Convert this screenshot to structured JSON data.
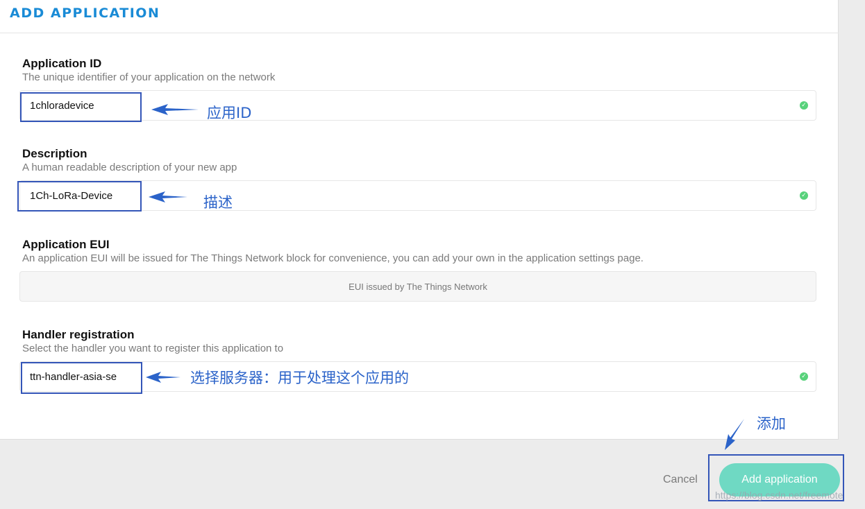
{
  "header": {
    "title": "ADD APPLICATION"
  },
  "fields": {
    "app_id": {
      "label": "Application ID",
      "help": "The unique identifier of your application on the network",
      "value": "1chloradevice",
      "annotation": "应用ID"
    },
    "description": {
      "label": "Description",
      "help": "A human readable description of your new app",
      "value": "1Ch-LoRa-Device",
      "annotation": "描述"
    },
    "eui": {
      "label": "Application EUI",
      "help": "An application EUI will be issued for The Things Network block for convenience, you can add your own in the application settings page.",
      "placeholder": "EUI issued by The Things Network"
    },
    "handler": {
      "label": "Handler registration",
      "help": "Select the handler you want to register this application to",
      "value": "ttn-handler-asia-se",
      "annotation": "选择服务器：用于处理这个应用的"
    }
  },
  "footer": {
    "cancel_label": "Cancel",
    "add_label": "Add application",
    "add_annotation": "添加"
  },
  "watermark": "https://blog.csdn.net/freemote",
  "colors": {
    "title": "#1a8bd6",
    "annotation": "#2b63c9",
    "valid": "#58d27b",
    "primary_button": "#6fd9c3"
  }
}
